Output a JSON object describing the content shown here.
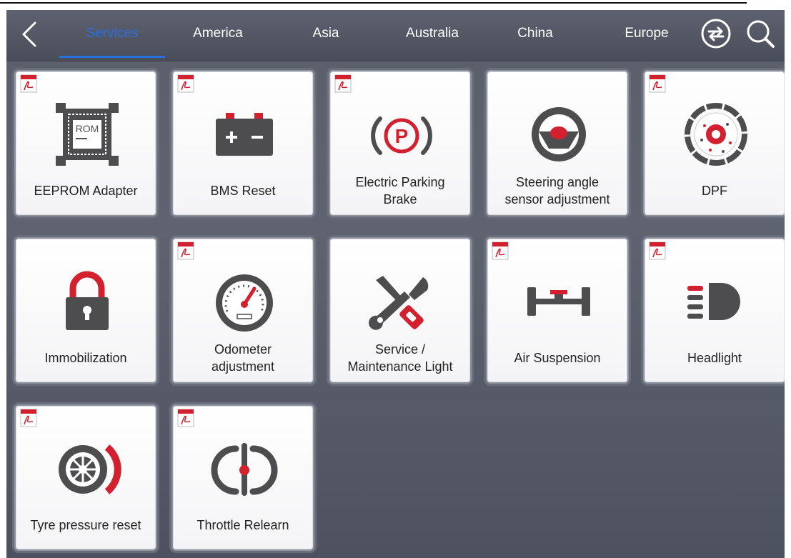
{
  "nav": {
    "tabs": [
      {
        "label": "Services",
        "active": true
      },
      {
        "label": "America"
      },
      {
        "label": "Asia"
      },
      {
        "label": "Australia"
      },
      {
        "label": "China"
      },
      {
        "label": "Europe"
      }
    ],
    "icons": [
      "back-chevron-icon",
      "swap-icon",
      "search-icon"
    ]
  },
  "colors": {
    "accent": "#2a6fe0",
    "icon_red": "#d3202f",
    "icon_gray": "#4d4d4f"
  },
  "tiles": [
    {
      "label": "EEPROM Adapter",
      "icon": "rom-chip-icon",
      "pdf": true,
      "chip_text": "ROM"
    },
    {
      "label": "BMS Reset",
      "icon": "battery-icon",
      "pdf": true
    },
    {
      "label": "Electric Parking\nBrake",
      "icon": "parking-brake-icon",
      "pdf": true,
      "brake_letter": "P"
    },
    {
      "label": "Steering angle\nsensor adjustment",
      "icon": "steering-wheel-icon",
      "pdf": false
    },
    {
      "label": "DPF",
      "icon": "dpf-filter-icon",
      "pdf": true
    },
    {
      "label": "Immobilization",
      "icon": "padlock-icon",
      "pdf": false
    },
    {
      "label": "Odometer\nadjustment",
      "icon": "odometer-icon",
      "pdf": true
    },
    {
      "label": "Service /\nMaintenance Light",
      "icon": "wrench-screwdriver-icon",
      "pdf": false
    },
    {
      "label": "Air Suspension",
      "icon": "axle-suspension-icon",
      "pdf": true
    },
    {
      "label": "Headlight",
      "icon": "headlight-icon",
      "pdf": true
    },
    {
      "label": "Tyre pressure reset",
      "icon": "tyre-icon",
      "pdf": true
    },
    {
      "label": "Throttle Relearn",
      "icon": "throttle-icon",
      "pdf": true
    }
  ]
}
